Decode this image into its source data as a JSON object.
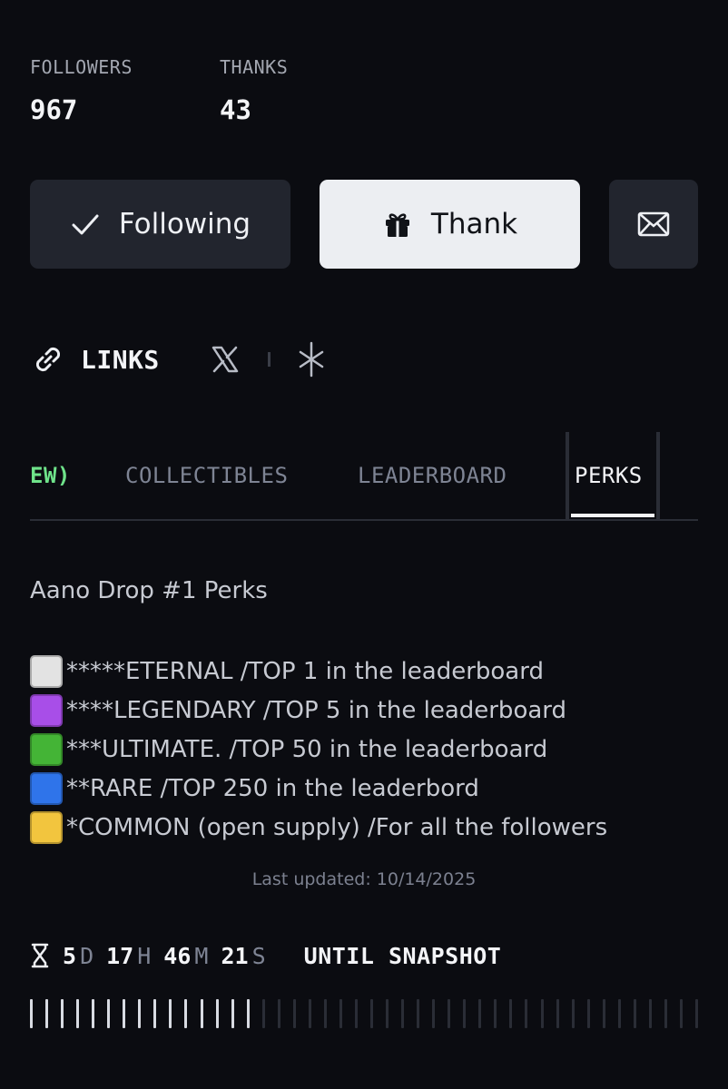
{
  "stats": {
    "followers_label": "FOLLOWERS",
    "followers_value": "967",
    "thanks_label": "THANKS",
    "thanks_value": "43"
  },
  "actions": {
    "following_label": "Following",
    "thank_label": "Thank",
    "following_icon": "check-icon",
    "thank_icon": "gift-icon",
    "message_icon": "mail-icon"
  },
  "links": {
    "label": "LINKS",
    "items": [
      {
        "icon": "x-logo-icon"
      },
      {
        "icon": "sparkle-icon"
      }
    ]
  },
  "tabs": {
    "items": [
      {
        "label": "EW)"
      },
      {
        "label": "COLLECTIBLES"
      },
      {
        "label": "LEADERBOARD"
      },
      {
        "label": "PERKS"
      }
    ],
    "active": "PERKS"
  },
  "perks": {
    "title": "Aano Drop #1 Perks",
    "items": [
      {
        "text": "*****ETERNAL /TOP 1 in the leaderboard",
        "color": "#e3e3e3"
      },
      {
        "text": "****LEGENDARY /TOP 5 in the leaderboard",
        "color": "#a84ee8"
      },
      {
        "text": "***ULTIMATE. /TOP 50 in the leaderboard",
        "color": "#44b436"
      },
      {
        "text": "**RARE /TOP 250 in the leaderbord",
        "color": "#2f74ea"
      },
      {
        "text": "*COMMON (open supply) /For all the followers",
        "color": "#f2c53e"
      }
    ],
    "last_updated": "Last updated: 10/14/2025"
  },
  "countdown": {
    "icon": "hourglass-icon",
    "days": "5",
    "days_unit": "D",
    "hours": "17",
    "hours_unit": "H",
    "minutes": "46",
    "minutes_unit": "M",
    "seconds": "21",
    "seconds_unit": "S",
    "suffix": "UNTIL SNAPSHOT"
  },
  "progress": {
    "filled_ticks": 15,
    "total_ticks": 44
  },
  "colors": {
    "background": "#0b0c11",
    "active_tab_accent": "#f3f4f7",
    "partial_tab": "#6fe38a"
  }
}
